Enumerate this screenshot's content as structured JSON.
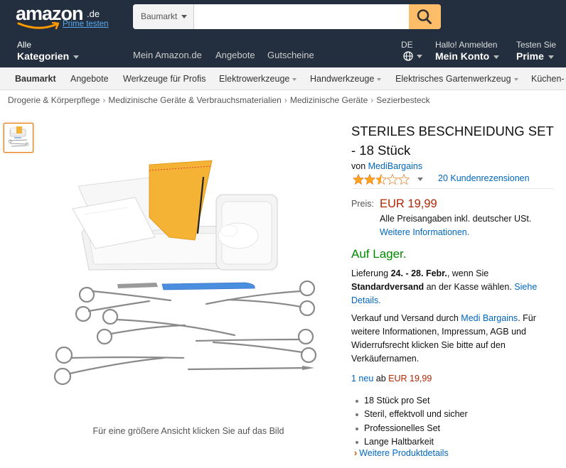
{
  "header": {
    "logo_text": "amazon",
    "logo_tld": ".de",
    "prime_link": "Prime testen",
    "search": {
      "category": "Baumarkt",
      "value": "",
      "placeholder": ""
    },
    "categories": {
      "line1": "Alle",
      "line2": "Kategorien"
    },
    "nav_links": [
      "Mein Amazon.de",
      "Angebote",
      "Gutscheine"
    ],
    "language": "DE",
    "account": {
      "line1": "Hallo! Anmelden",
      "line2": "Mein Konto"
    },
    "prime": {
      "line1": "Testen Sie",
      "line2": "Prime"
    }
  },
  "subnav": {
    "items": [
      "Baumarkt",
      "Angebote",
      "Werkzeuge für Profis",
      "Elektrowerkzeuge",
      "Handwerkzeuge",
      "Elektrisches Gartenwerkzeug",
      "Küchen-"
    ]
  },
  "breadcrumb": [
    "Drogerie & Körperpflege",
    "Medizinische Geräte & Verbrauchsmaterialien",
    "Medizinische Geräte",
    "Sezierbesteck"
  ],
  "image_caption": "Für eine größere Ansicht klicken Sie auf das Bild",
  "product": {
    "title": "STERILES BESCHNEIDUNG SET - 18 Stück",
    "by_prefix": "von",
    "brand": "MediBargains",
    "rating": 2.5,
    "rating_max": 5,
    "reviews": "20 Kundenrezensionen",
    "price_label": "Preis:",
    "price": "EUR 19,99",
    "vat_note": "Alle Preisangaben inkl. deutscher USt.",
    "more_info": "Weitere Informationen.",
    "availability": "Auf Lager.",
    "delivery": {
      "prefix": "Lieferung ",
      "dates": "24. - 28. Febr.",
      "middle": ", wenn Sie ",
      "method": "Standardversand",
      "suffix": " an der Kasse wählen. ",
      "link": "Siehe Details."
    },
    "seller": {
      "prefix": "Verkauf und Versand durch ",
      "name": "Medi Bargains",
      "suffix": ". Für weitere Informationen, Impressum, AGB und Widerrufsrecht klicken Sie bitte auf den Verkäufernamen."
    },
    "offers": {
      "link": "1 neu",
      "middle": " ab ",
      "price": "EUR 19,99"
    },
    "bullets": [
      "18 Stück pro Set",
      "Steril, effektvoll und sicher",
      "Professionelles Set",
      "Lange Haltbarkeit"
    ],
    "more_details": "Weitere Produktdetails"
  },
  "colors": {
    "header_bg": "#232f3e",
    "search_button": "#febd69",
    "link": "#0066c0",
    "price": "#b12704",
    "in_stock": "#008a00",
    "star": "#ffa41c"
  }
}
